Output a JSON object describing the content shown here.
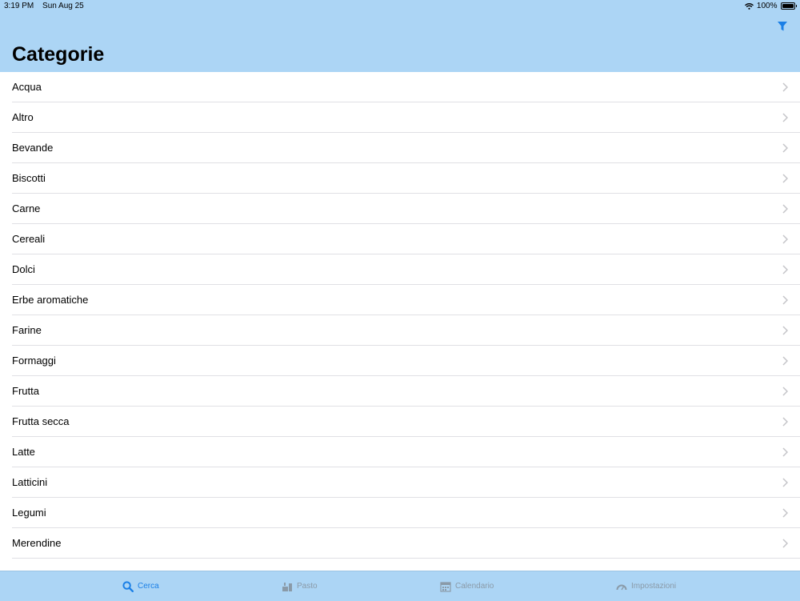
{
  "status_bar": {
    "time": "3:19 PM",
    "date": "Sun Aug 25",
    "battery": "100%"
  },
  "nav": {
    "title": "Categorie",
    "filter_icon": "filter-icon"
  },
  "categories": [
    "Acqua",
    "Altro",
    "Bevande",
    "Biscotti",
    "Carne",
    "Cereali",
    "Dolci",
    "Erbe aromatiche",
    "Farine",
    "Formaggi",
    "Frutta",
    "Frutta secca",
    "Latte",
    "Latticini",
    "Legumi",
    "Merendine"
  ],
  "tabs": [
    {
      "label": "Cerca",
      "icon": "search-icon",
      "active": true
    },
    {
      "label": "Pasto",
      "icon": "meal-icon",
      "active": false
    },
    {
      "label": "Calendario",
      "icon": "calendar-icon",
      "active": false
    },
    {
      "label": "Impostazioni",
      "icon": "settings-icon",
      "active": false
    }
  ],
  "colors": {
    "bar_background": "#acd5f5",
    "accent": "#1a7fe6",
    "inactive_tab": "#8a9aa8"
  }
}
